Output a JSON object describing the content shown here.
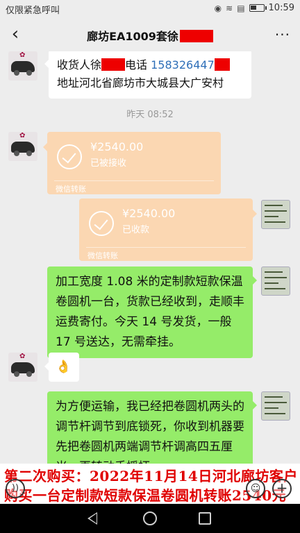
{
  "status_bar": {
    "carrier_text": "仅限紧急呼叫",
    "time": "10:59",
    "battery_level": 0.45,
    "icons": [
      "eye-icon",
      "wifi-icon",
      "sim-icon",
      "battery-icon"
    ]
  },
  "nav": {
    "title": "廊坊EA1009套徐",
    "back_icon": "chevron-left-icon",
    "more_label": "···"
  },
  "messages": {
    "m1": {
      "line1_a": "收货人徐",
      "line1_b": "电话",
      "phone": "158326447",
      "line2": "地址河北省廊坊市大城县大广安村"
    },
    "timestamp": "昨天 08:52",
    "t1": {
      "amount": "¥2540.00",
      "status": "已被接收",
      "foot": "微信转账"
    },
    "t2": {
      "amount": "¥2540.00",
      "status": "已收款",
      "foot": "微信转账"
    },
    "m2": {
      "text": "加工宽度 1.08 米的定制款短款保温卷圆机一台，货款已经收到，走顺丰运费寄付。今天 14 号发货，一般 17 号送达，无需牵挂。"
    },
    "m3": {
      "emoji": "👌"
    },
    "m4": {
      "text": "为方便运输，我已经把卷圆机两头的调节杆调节到底锁死，你收到机器要先把卷圆机两端调节杆调高四五厘米，再转动手摇柄。"
    }
  },
  "caption": {
    "line1": "第二次购买：2022年11月14日河北廊坊客户",
    "line2": "购买一台定制款短款保温卷圆机转账2540元"
  },
  "input_bar": {
    "voice_icon": "voice-icon",
    "emoji_icon": "emoji-icon",
    "plus_icon": "plus-icon"
  },
  "colors": {
    "chat_bg": "#ededed",
    "green_bubble": "#95ec69",
    "transfer_bg": "#fbd7b2",
    "caption_red": "#e00000",
    "redact": "#ee0000"
  }
}
